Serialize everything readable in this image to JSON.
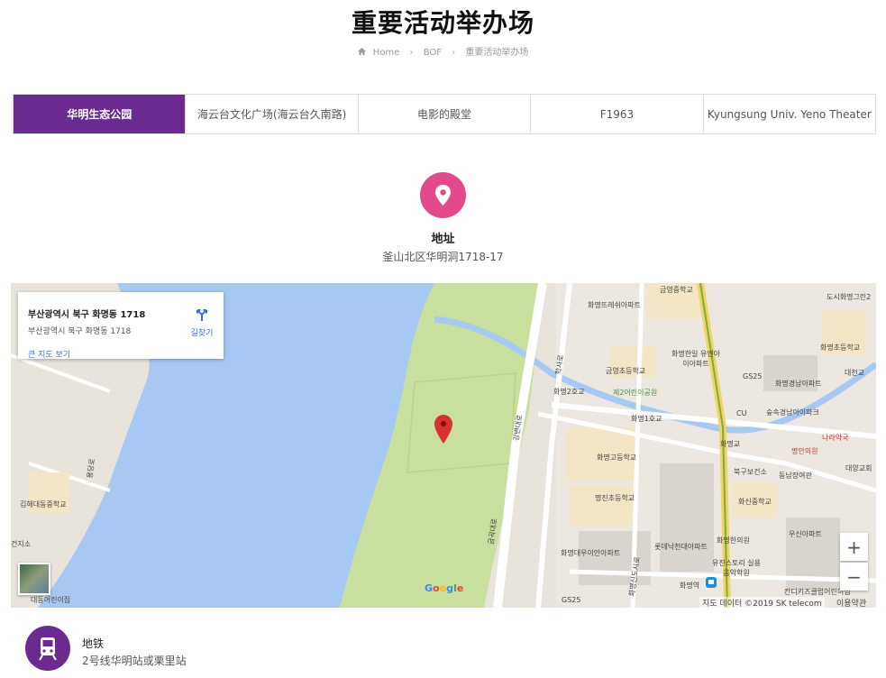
{
  "page": {
    "title": "重要活动举办场"
  },
  "breadcrumb": {
    "home": "Home",
    "level1": "BOF",
    "current": "重要活动举办场"
  },
  "tabs": [
    {
      "label": "华明生态公园",
      "active": true
    },
    {
      "label": "海云台文化广场(海云台久南路)",
      "active": false
    },
    {
      "label": "电影的殿堂",
      "active": false
    },
    {
      "label": "F1963",
      "active": false
    },
    {
      "label": "Kyungsung Univ. Yeno Theater",
      "active": false
    }
  ],
  "address": {
    "icon": "map-pin-icon",
    "heading": "地址",
    "text": "釜山北区华明洞1718-17"
  },
  "map": {
    "card": {
      "title": "부산광역시 북구 화명동 1718",
      "subtitle": "부산광역시 북구 화명동 1718",
      "directions": "길찾기",
      "larger_map": "큰 지도 보기"
    },
    "labels": {
      "l1": "금영중학교",
      "l2": "화명뜨레쉬아파트",
      "l3": "도시화명그린2",
      "l4": "화명초등학교",
      "l5": "화명한일 유엔아이아파트",
      "l6": "금영초등학교",
      "l7": "GS25",
      "l8": "대천교",
      "l9": "화명2호교",
      "l10": "제2어린이공원",
      "l11": "화명경남아파트",
      "l12": "화명1호교",
      "l13": "CU",
      "l14": "숲속경남아이파크",
      "l15": "화명교",
      "l16": "나라약국",
      "l17": "명안의원",
      "l18": "화명고등학교",
      "l19": "북구보건소",
      "l20": "동남장여관",
      "l21": "대양교회",
      "l22": "명진초등학교",
      "l23": "화신중학교",
      "l24": "김해대동중학교",
      "l25": "건지소",
      "l26": "화명대우이안아파트",
      "l27": "롯데낙천대아파트",
      "l28": "화명한의원",
      "l29": "우신아파트",
      "l30": "유진스토리 실용음악학원",
      "l31": "화명역",
      "l32": "대동어린이집",
      "l33": "GS25",
      "l34": "칸디키즈클럽어린이집",
      "l35": "강변대로",
      "l36": "학사로",
      "l37": "용당로",
      "l38": "화명신도시로",
      "l39": "금곡대로"
    },
    "zoom_in": "+",
    "zoom_out": "−",
    "google": "Google",
    "attribution": "지도 데이터 ©2019 SK telecom",
    "terms": "이용약관",
    "colors": {
      "water": "#a7c8f2",
      "park": "#c8df9e",
      "road": "#ffffff",
      "highway": "#f4d35e",
      "marker": "#d9322e"
    }
  },
  "subway": {
    "icon": "train-icon",
    "heading": "地铁",
    "text": "2号线华明站或栗里站"
  },
  "colors": {
    "primary": "#6b2a8f",
    "pin": "#e24a8b"
  }
}
